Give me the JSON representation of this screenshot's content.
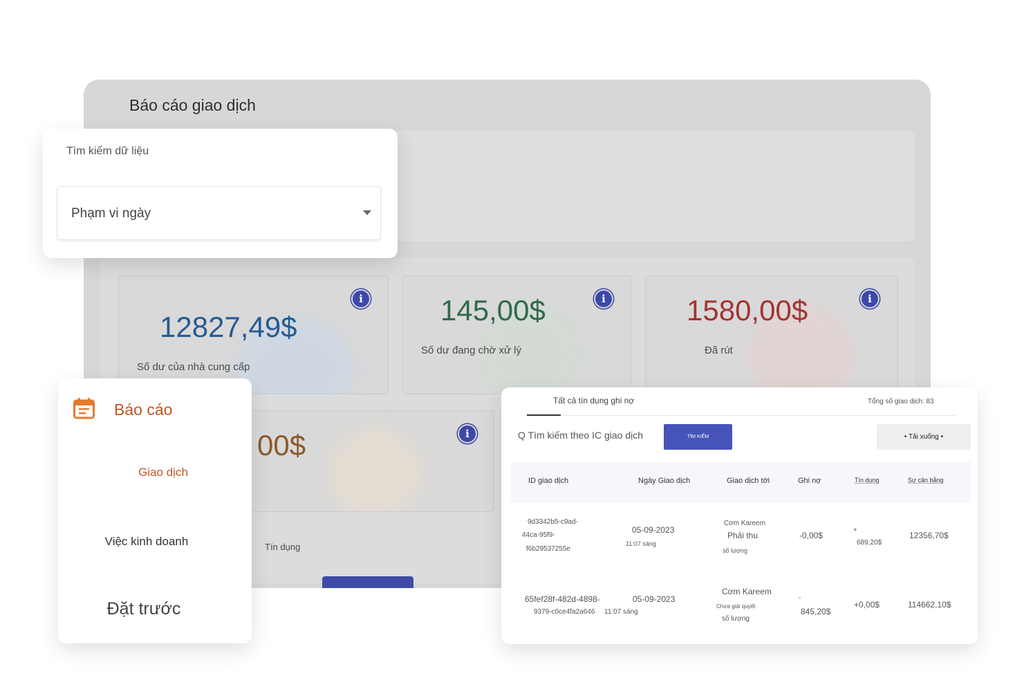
{
  "report": {
    "title": "Báo cáo giao dịch",
    "cards": [
      {
        "value": "12827,49$",
        "label": "Số dư của nhà cung cấp",
        "color": "#255b93"
      },
      {
        "value": "145,00$",
        "label": "Số dư đang chờ xử lý",
        "color": "#2f6b4a"
      },
      {
        "value": "1580,00$",
        "label": "Đã rút",
        "color": "#a33432"
      },
      {
        "value": "00$",
        "color": "#8a5b2a"
      }
    ],
    "credit_label": "Tín dụng"
  },
  "search": {
    "title": "Tìm kiếm dữ liệu",
    "date_range": "Phạm vi ngày"
  },
  "nav": {
    "header": "Báo cáo",
    "items": [
      "Giao dịch",
      "Việc kinh doanh",
      "Đặt trước"
    ]
  },
  "transactions": {
    "tab": "Tất cả tín dụng ghi nợ",
    "total": "Tổng số giao dịch: 83",
    "search_placeholder": "Q Tìm kiếm theo IC giao dịch",
    "search_button": "TÌM KIẾM",
    "download_button": "• Tải xuống •",
    "columns": [
      "ID giao dịch",
      "Ngày Giao dịch",
      "Giao dịch tới",
      "Ghi nợ",
      "Tín dụng",
      "Sự cân bằng"
    ],
    "rows": [
      {
        "id_lines": [
          "9d3342b5-c9ad-",
          "44ca-95f9-",
          "f6b29537255e"
        ],
        "date": "05-09-2023",
        "time": "11:07 sáng",
        "to_name": "Cơm Kareem",
        "to_status": "Phải thu",
        "to_sub": "số lượng",
        "debit": "-0,00$",
        "credit_lines": [
          "+",
          "689,20$"
        ],
        "balance": "12356,70$"
      },
      {
        "id_lines": [
          "65fef28f-482d-4898-",
          "9379-c0ce4fa2a646"
        ],
        "date": "05-09-2023",
        "time": "11:07 sáng",
        "to_name": "Cơm Kareem",
        "to_status": "Chưa giải quyết",
        "to_sub": "số lượng",
        "debit_lines": [
          "-",
          "845,20$"
        ],
        "credit": "+0,00$",
        "balance": "114662,10$"
      }
    ]
  }
}
